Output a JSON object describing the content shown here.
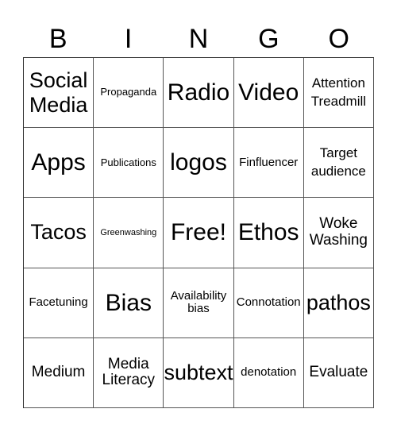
{
  "header": {
    "letters": [
      "B",
      "I",
      "N",
      "G",
      "O"
    ]
  },
  "cells": [
    {
      "text": "Social Media",
      "size": "s-l"
    },
    {
      "text": "Propaganda",
      "size": "s-xs"
    },
    {
      "text": "Radio",
      "size": "s-xl"
    },
    {
      "text": "Video",
      "size": "s-xl"
    },
    {
      "text": "Attention Treadmill",
      "size": "s-ms"
    },
    {
      "text": "Apps",
      "size": "s-xl"
    },
    {
      "text": "Publications",
      "size": "s-xs"
    },
    {
      "text": "logos",
      "size": "s-xl"
    },
    {
      "text": "Finfluencer",
      "size": "s-s"
    },
    {
      "text": "Target audience",
      "size": "s-ms"
    },
    {
      "text": "Tacos",
      "size": "s-l"
    },
    {
      "text": "Greenwashing",
      "size": "s-xxs"
    },
    {
      "text": "Free!",
      "size": "s-xl"
    },
    {
      "text": "Ethos",
      "size": "s-xl"
    },
    {
      "text": "Woke Washing",
      "size": "s-m"
    },
    {
      "text": "Facetuning",
      "size": "s-s"
    },
    {
      "text": "Bias",
      "size": "s-xl"
    },
    {
      "text": "Availability bias",
      "size": "s-s"
    },
    {
      "text": "Connotation",
      "size": "s-s"
    },
    {
      "text": "pathos",
      "size": "s-l"
    },
    {
      "text": "Medium",
      "size": "s-m"
    },
    {
      "text": "Media Literacy",
      "size": "s-m"
    },
    {
      "text": "subtext",
      "size": "s-l"
    },
    {
      "text": "denotation",
      "size": "s-s"
    },
    {
      "text": "Evaluate",
      "size": "s-m"
    }
  ]
}
